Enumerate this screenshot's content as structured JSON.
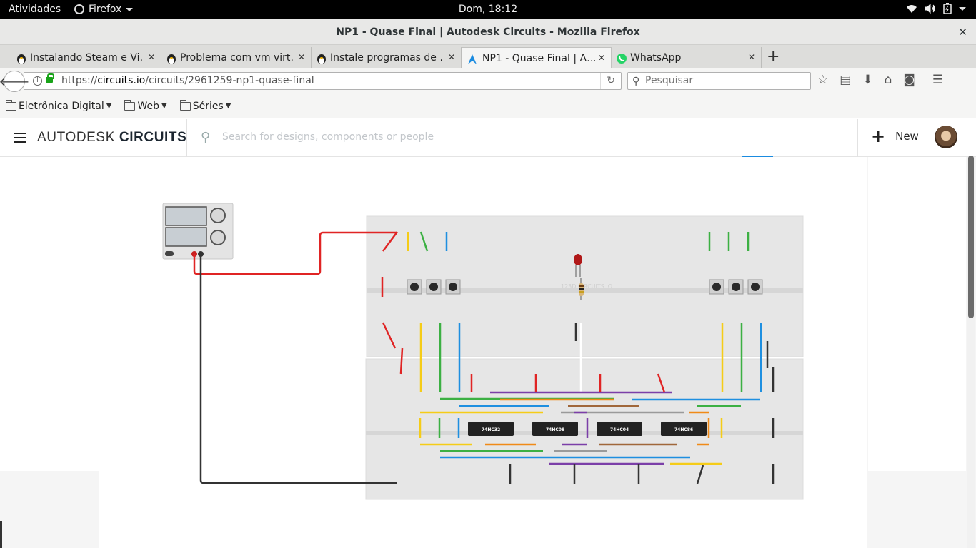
{
  "system_bar": {
    "activities": "Atividades",
    "app_menu": "Firefox",
    "clock": "Dom, 18:12"
  },
  "window": {
    "title": "NP1 - Quase Final | Autodesk Circuits - Mozilla Firefox",
    "close": "✕"
  },
  "tabs": [
    {
      "label": "Instalando Steam e Vi…",
      "icon": "tux-icon",
      "active": false
    },
    {
      "label": "Problema com vm virt…",
      "icon": "tux-icon",
      "active": false
    },
    {
      "label": "Instale programas de …",
      "icon": "tux-icon",
      "active": false
    },
    {
      "label": "NP1 - Quase Final | A…",
      "icon": "autodesk-icon",
      "active": true
    },
    {
      "label": "WhatsApp",
      "icon": "whatsapp-icon",
      "active": false
    }
  ],
  "navbar": {
    "url_prefix": "https://",
    "url_host": "circuits.io",
    "url_path": "/circuits/2961259-np1-quase-final",
    "search_placeholder": "Pesquisar"
  },
  "bookmarks": [
    {
      "label": "Eletrônica Digital"
    },
    {
      "label": "Web"
    },
    {
      "label": "Séries"
    }
  ],
  "app": {
    "brand_light": "AUTODESK",
    "brand_bold": "CIRCUITS",
    "search_placeholder": "Search for designs, components or people",
    "new_label": "New"
  },
  "circuit": {
    "chips": [
      "74HC32",
      "74HC08",
      "74HC04",
      "74HC86"
    ],
    "watermark": "123D CIRCUITS.IO",
    "colors": {
      "red": "#e02424",
      "black": "#333333",
      "yellow": "#f5cc18",
      "green": "#3cb043",
      "blue": "#1e8fe0",
      "orange": "#f08a18",
      "purple": "#7b3fa8",
      "gray": "#9a9a9a",
      "brown": "#a0673a",
      "breadboard": "#e6e6e6"
    }
  }
}
